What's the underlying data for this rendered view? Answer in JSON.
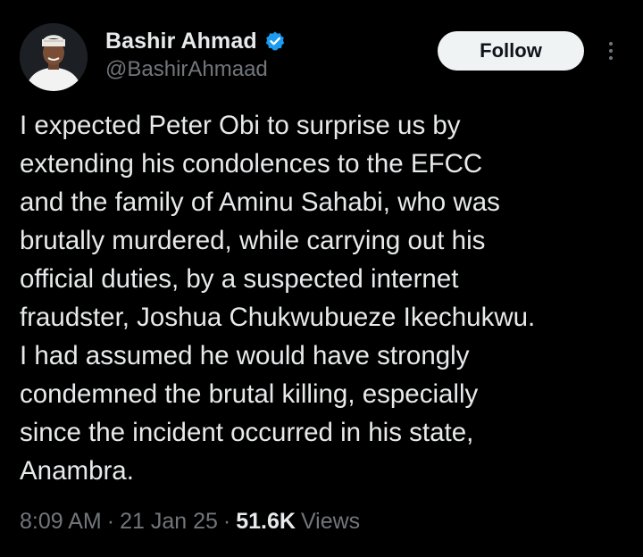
{
  "author": {
    "display_name": "Bashir Ahmad",
    "handle": "@BashirAhmaad",
    "verified": true,
    "verified_color": "#1d9bf0"
  },
  "actions": {
    "follow_label": "Follow",
    "more_icon": "more-vertical-icon"
  },
  "tweet": {
    "text": "I expected Peter Obi to surprise us by\nextending his condolences to the EFCC\nand the family of Aminu Sahabi, who was\nbrutally murdered, while carrying out his\nofficial duties, by a suspected internet\nfraudster, Joshua Chukwubueze Ikechukwu.\nI had assumed he would have strongly\ncondemned the brutal killing, especially\nsince the incident occurred in his state,\nAnambra."
  },
  "meta": {
    "time": "8:09 AM",
    "date": "21 Jan 25",
    "separator": "·",
    "views_count": "51.6K",
    "views_label": "Views"
  },
  "colors": {
    "background": "#000000",
    "text_primary": "#e7e9ea",
    "text_secondary": "#71767b",
    "follow_bg": "#eff3f4",
    "follow_text": "#0f1419"
  }
}
